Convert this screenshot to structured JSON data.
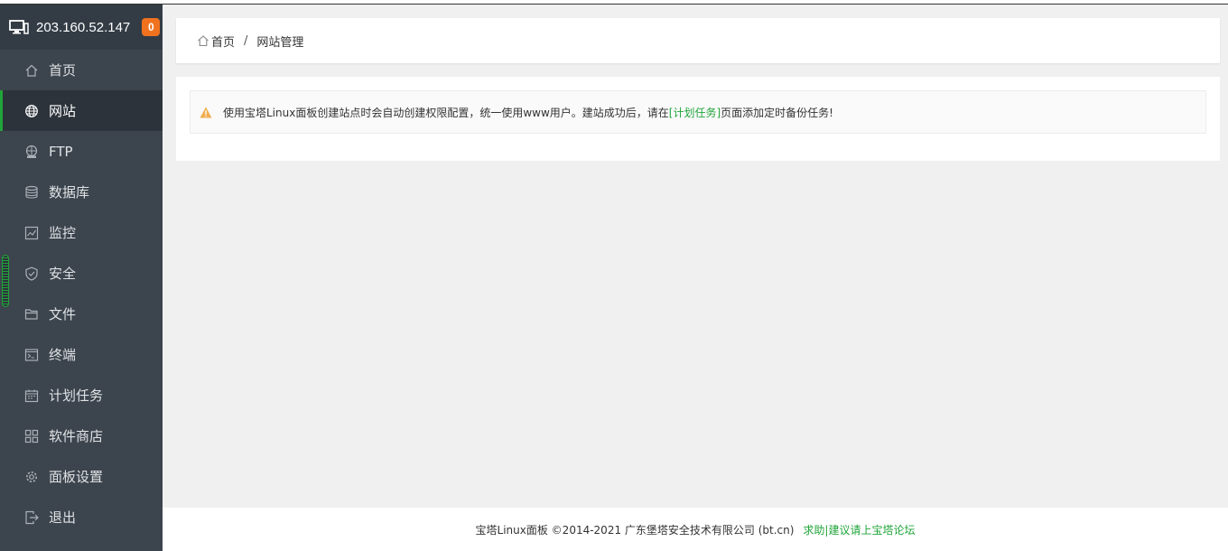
{
  "server": {
    "ip": "203.160.52.147",
    "badge": "0"
  },
  "menu": [
    {
      "label": "首页",
      "icon": "home-icon"
    },
    {
      "label": "网站",
      "icon": "globe-icon",
      "active": true
    },
    {
      "label": "FTP",
      "icon": "ftp-icon"
    },
    {
      "label": "数据库",
      "icon": "database-icon"
    },
    {
      "label": "监控",
      "icon": "monitor-chart-icon"
    },
    {
      "label": "安全",
      "icon": "shield-icon"
    },
    {
      "label": "文件",
      "icon": "folder-icon"
    },
    {
      "label": "终端",
      "icon": "terminal-icon"
    },
    {
      "label": "计划任务",
      "icon": "calendar-icon"
    },
    {
      "label": "软件商店",
      "icon": "grid-apps-icon"
    },
    {
      "label": "面板设置",
      "icon": "gear-icon"
    },
    {
      "label": "退出",
      "icon": "logout-icon"
    }
  ],
  "breadcrumb": {
    "home": "首页",
    "separator": "/",
    "current": "网站管理"
  },
  "notice": {
    "text_before": "使用宝塔Linux面板创建站点时会自动创建权限配置，统一使用www用户。建站成功后，请在",
    "link": "[计划任务]",
    "text_after": "页面添加定时备份任务!"
  },
  "footer": {
    "copyright": "宝塔Linux面板 ©2014-2021 广东堡塔安全技术有限公司 (bt.cn)",
    "link": "求助|建议请上宝塔论坛"
  },
  "colors": {
    "accent": "#20a53a",
    "sidebar": "#3c444d",
    "badge": "#f0721e",
    "warning": "#f0ad4e"
  }
}
